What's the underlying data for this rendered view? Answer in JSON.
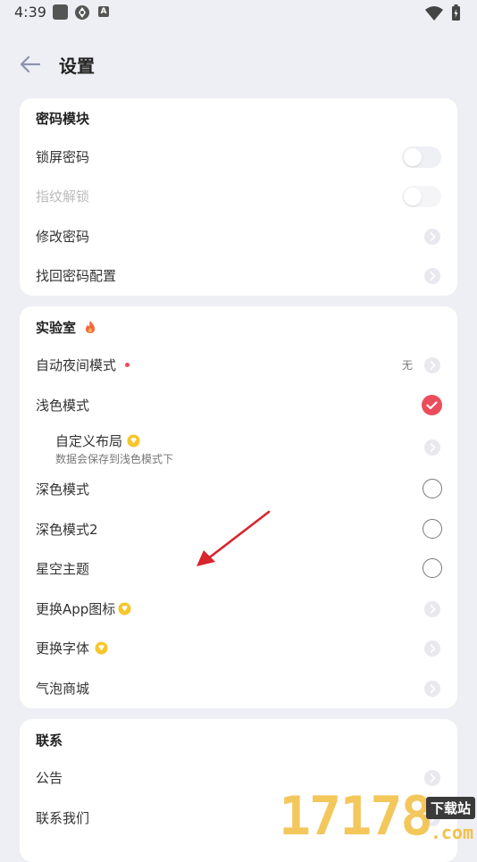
{
  "status_bar": {
    "time": "4:39",
    "notif_icon_a": "A"
  },
  "header": {
    "title": "设置"
  },
  "password_section": {
    "title": "密码模块",
    "items": [
      {
        "label": "锁屏密码",
        "control": "toggle",
        "enabled": true,
        "on": false
      },
      {
        "label": "指纹解锁",
        "control": "toggle",
        "enabled": false,
        "on": false
      },
      {
        "label": "修改密码",
        "control": "chevron"
      },
      {
        "label": "找回密码配置",
        "control": "chevron"
      }
    ]
  },
  "lab_section": {
    "title": "实验室",
    "title_icon": "flame-icon",
    "items": [
      {
        "label": "自动夜间模式",
        "control": "chevron",
        "value": "无",
        "badge": "red-dot"
      },
      {
        "label": "浅色模式",
        "control": "radio",
        "checked": true
      },
      {
        "label": "自定义布局",
        "subtitle": "数据会保存到浅色模式下",
        "control": "chevron",
        "badge": "vip-icon"
      },
      {
        "label": "深色模式",
        "control": "radio",
        "checked": false
      },
      {
        "label": "深色模式2",
        "control": "radio",
        "checked": false
      },
      {
        "label": "星空主题",
        "control": "radio",
        "checked": false
      },
      {
        "label": "更换App图标",
        "control": "chevron",
        "badge": "vip-icon"
      },
      {
        "label": "更换字体",
        "control": "chevron",
        "badge": "vip-icon"
      },
      {
        "label": "气泡商城",
        "control": "chevron"
      }
    ]
  },
  "contact_section": {
    "title": "联系",
    "items": [
      {
        "label": "公告",
        "control": "chevron"
      },
      {
        "label": "联系我们",
        "control": "chevron"
      }
    ]
  },
  "watermark": {
    "number": "17178",
    "tag": "下载站",
    "domain": ".com"
  },
  "colors": {
    "background": "#eeeff4",
    "accent": "#ec4d5c",
    "vip": "#f6c62a"
  }
}
